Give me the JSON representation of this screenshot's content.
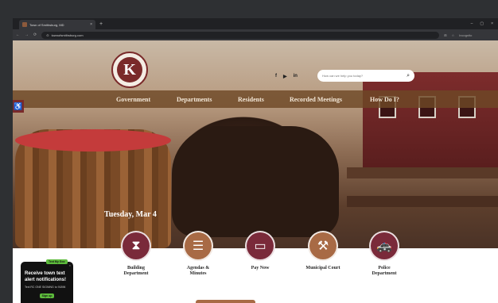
{
  "browser": {
    "tab_title": "Town of Smithsburg, MD",
    "tab_close": "×",
    "new_tab": "+",
    "window_controls": [
      "–",
      "▢",
      "×"
    ],
    "nav_buttons": [
      "←",
      "→",
      "⟳"
    ],
    "url": "townofsmithsburg.com",
    "profile_label": "Incognito"
  },
  "header": {
    "logo_letter": "K",
    "social": [
      "f",
      "▶",
      "in"
    ],
    "search_placeholder": "How can we help you today?",
    "accessibility_icon": "♿"
  },
  "nav": {
    "items": [
      "Government",
      "Departments",
      "Residents",
      "Recorded Meetings",
      "How Do I?"
    ]
  },
  "hero": {
    "date": "Tuesday, Mar 4"
  },
  "quick_links": [
    {
      "label": "Building\nDepartment",
      "icon": "hourglass-icon",
      "glyph": "⧗",
      "color": "#7a2a3a"
    },
    {
      "label": "Agendas &\nMinutes",
      "icon": "list-icon",
      "glyph": "☰",
      "color": "#a86a45"
    },
    {
      "label": "Pay Now",
      "icon": "credit-card-icon",
      "glyph": "▭",
      "color": "#7a2a3a"
    },
    {
      "label": "Municipal Court",
      "icon": "gavel-icon",
      "glyph": "⚒",
      "color": "#a86a45"
    },
    {
      "label": "Police\nDepartment",
      "icon": "police-car-icon",
      "glyph": "🚓",
      "color": "#7a2a3a"
    }
  ],
  "alert_widget": {
    "badge": "Text My Gov",
    "title": "Receive town text alert notifications!",
    "subtitle": "Text RC ONE SIGNING to 91896",
    "button": "Sign up",
    "close": "×",
    "prev": "‹",
    "next": "›"
  }
}
